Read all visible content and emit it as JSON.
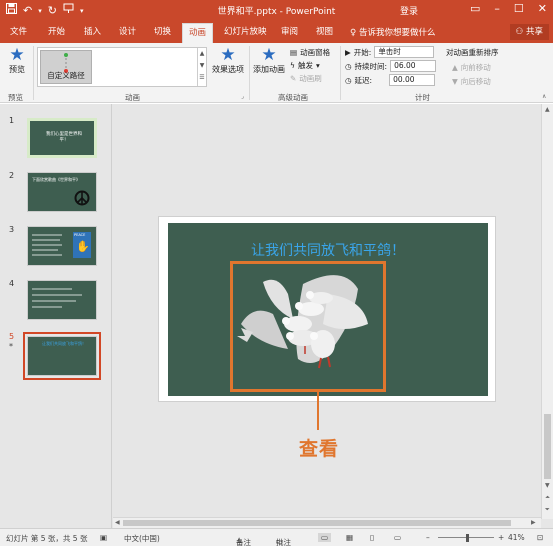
{
  "app": {
    "title": "世界和平.pptx - PowerPoint",
    "login": "登录"
  },
  "qat": {
    "save_icon": "save-icon",
    "undo_icon": "undo-icon",
    "redo_icon": "repeat-icon",
    "start_icon": "present-from-start-icon"
  },
  "window": {
    "restore": "▭",
    "minimize": "–",
    "maximize": "☐",
    "close": "✕"
  },
  "tabs": [
    "文件",
    "开始",
    "插入",
    "设计",
    "切换",
    "动画",
    "幻灯片放映",
    "审阅",
    "视图"
  ],
  "active_tab": "动画",
  "tellme": "告诉我你想要做什么",
  "share": "共享",
  "ribbon": {
    "preview_label": "预览",
    "effect_selected": "自定义路径",
    "effect_options": "效果选项",
    "add_animation": "添加动画",
    "animation_pane": "动画窗格",
    "trigger": "触发",
    "animation_painter": "动画刷",
    "start_label": "开始:",
    "start_value": "单击时",
    "duration_label": "持续时间:",
    "duration_value": "06.00",
    "delay_label": "延迟:",
    "delay_value": "00.00",
    "reorder_title": "对动画重新排序",
    "move_earlier": "向前移动",
    "move_later": "向后移动",
    "groups": {
      "preview": "预览",
      "animation": "动画",
      "advanced": "高级动画",
      "timing": "计时"
    }
  },
  "thumbnails": [
    {
      "num": "1",
      "text": "我们心里是世界和平！"
    },
    {
      "num": "2",
      "text": "下面欣赏歌曲《世界和平》"
    },
    {
      "num": "3",
      "text": "PEACE"
    },
    {
      "num": "4",
      "text": ""
    },
    {
      "num": "5",
      "marker": "*",
      "text": "让我们共同放飞和平鸽！"
    }
  ],
  "slide": {
    "title": "让我们共同放飞和平鸽！"
  },
  "callout": "查看",
  "statusbar": {
    "slide_info": "幻灯片 第 5 张，共 5 张",
    "language": "中文(中国)",
    "notes": "备注",
    "comments": "批注",
    "zoom": "41%"
  },
  "colors": {
    "accent": "#c9482b",
    "slide_bg": "#3e5e50",
    "title_blue": "#3aa5ea",
    "highlight_orange": "#e0762e"
  }
}
